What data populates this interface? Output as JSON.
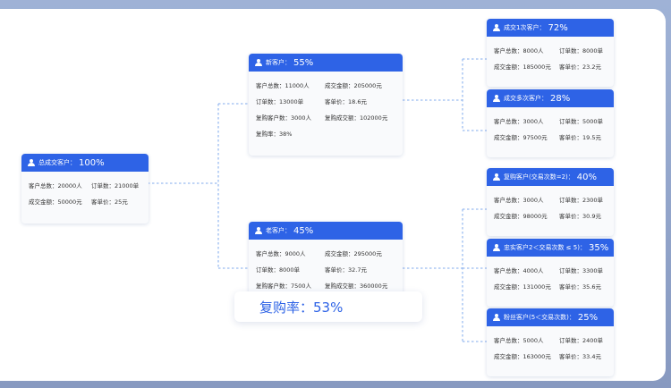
{
  "root": {
    "title": "总成交客户：",
    "pct": "100%",
    "rows": [
      [
        "客户总数：20000人",
        "订单数：21000单"
      ],
      [
        "成交金额：50000元",
        "客单价：25元"
      ]
    ]
  },
  "new_customers": {
    "title": "新客户：",
    "pct": "55%",
    "rows": [
      [
        "客户总数：11000人",
        "成交金额：205000元"
      ],
      [
        "订单数：13000单",
        "客单价：18.6元"
      ],
      [
        "复购客户数：3000人",
        "复购成交额：102000元"
      ],
      [
        "复购率：38%"
      ]
    ]
  },
  "old_customers": {
    "title": "老客户：",
    "pct": "45%",
    "rows": [
      [
        "客户总数：9000人",
        "成交金额：295000元"
      ],
      [
        "订单数：8000单",
        "客单价：32.7元"
      ],
      [
        "复购客户数：7500人",
        "复购成交额：360000元"
      ]
    ]
  },
  "repurchase_rate": "复购率：53%",
  "leaves": [
    {
      "title": "成交1次客户：",
      "pct": "72%",
      "rows": [
        [
          "客户总数：8000人",
          "订单数：8000单"
        ],
        [
          "成交金额：185000元",
          "客单价：23.2元"
        ]
      ]
    },
    {
      "title": "成交多次客户：",
      "pct": "28%",
      "rows": [
        [
          "客户总数：3000人",
          "订单数：5000单"
        ],
        [
          "成交金额：97500元",
          "客单价：19.5元"
        ]
      ]
    },
    {
      "title": "复购客户(交易次数=2)：",
      "pct": "40%",
      "rows": [
        [
          "客户总数：3000人",
          "订单数：2300单"
        ],
        [
          "成交金额：98000元",
          "客单价：30.9元"
        ]
      ]
    },
    {
      "title": "忠实客户2＜交易次数 ≤ 5)：",
      "pct": "35%",
      "rows": [
        [
          "客户总数：4000人",
          "订单数：3300单"
        ],
        [
          "成交金额：131000元",
          "客单价：35.6元"
        ]
      ]
    },
    {
      "title": "粉丝客户(5＜交易次数)：",
      "pct": "25%",
      "rows": [
        [
          "客户总数：5000人",
          "订单数：2400单"
        ],
        [
          "成交金额：163000元",
          "客单价：33.4元"
        ]
      ]
    }
  ],
  "colors": {
    "accent": "#2e63e6",
    "connector": "#9bbcf0",
    "card_bg": "#f9fafc"
  }
}
